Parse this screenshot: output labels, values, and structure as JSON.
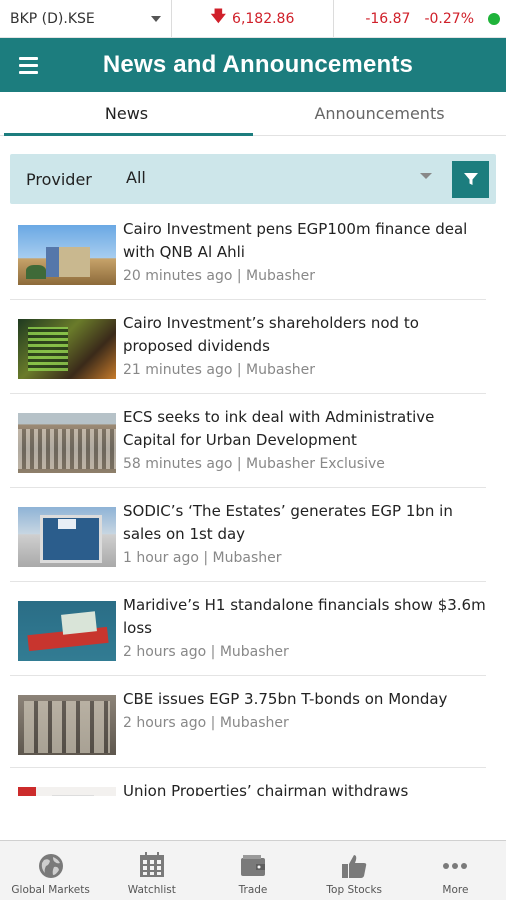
{
  "ticker": {
    "symbol": "BKP (D).KSE",
    "price": "6,182.86",
    "change": "-16.87",
    "change_pct": "-0.27%",
    "status_color": "#1fb33a",
    "down_color": "#d0202a"
  },
  "header": {
    "title": "News and Announcements",
    "menu_icon": "hamburger-menu-icon"
  },
  "tabs": [
    {
      "label": "News",
      "active": true
    },
    {
      "label": "Announcements",
      "active": false
    }
  ],
  "filter": {
    "label": "Provider",
    "selected": "All",
    "filter_icon": "funnel-icon"
  },
  "news": [
    {
      "headline": "Cairo Investment pens EGP100m finance deal with QNB Al Ahli",
      "meta": "20 minutes ago | Mubasher"
    },
    {
      "headline": "Cairo Investment’s shareholders nod to proposed dividends",
      "meta": "21 minutes ago | Mubasher"
    },
    {
      "headline": "ECS seeks to ink deal with Administrative Capital for Urban Development",
      "meta": "58 minutes ago | Mubasher Exclusive"
    },
    {
      "headline": "SODIC’s ‘The Estates’ generates EGP 1bn in sales on 1st day",
      "meta": "1 hour ago | Mubasher"
    },
    {
      "headline": "Maridive’s H1 standalone financials show $3.6m loss",
      "meta": "2 hours ago | Mubasher"
    },
    {
      "headline": "CBE issues EGP 3.75bn T-bonds on Monday",
      "meta": "2 hours ago | Mubasher"
    },
    {
      "headline": "Union Properties’ chairman withdraws resignation",
      "meta": ""
    }
  ],
  "bottom_nav": [
    {
      "label": "Global Markets",
      "icon": "globe-icon"
    },
    {
      "label": "Watchlist",
      "icon": "calendar-grid-icon"
    },
    {
      "label": "Trade",
      "icon": "wallet-icon"
    },
    {
      "label": "Top Stocks",
      "icon": "thumbs-up-icon"
    },
    {
      "label": "More",
      "icon": "more-dots-icon"
    }
  ],
  "colors": {
    "accent": "#1c7d7e",
    "filter_bg": "#cde6ea"
  }
}
